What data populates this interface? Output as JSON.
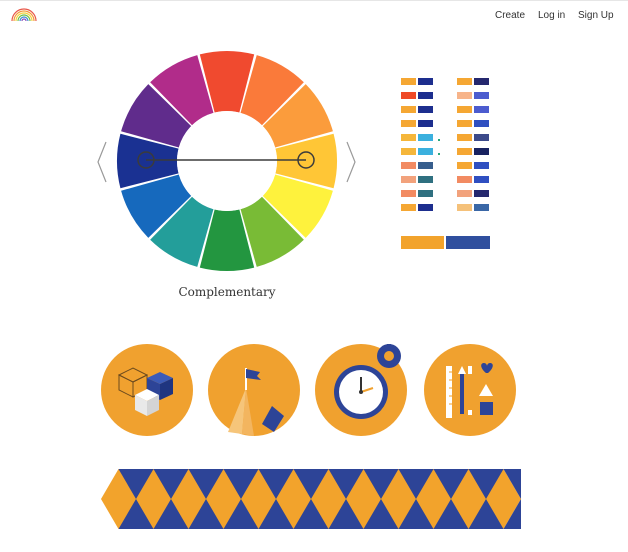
{
  "header": {
    "logo_icon": "rainbow-logo",
    "nav": [
      {
        "label": "Create"
      },
      {
        "label": "Log in"
      },
      {
        "label": "Sign Up"
      }
    ]
  },
  "wheel": {
    "scheme_label": "Complementary",
    "segment_colors": [
      "#f04a2f",
      "#fa7a3a",
      "#fb9c3c",
      "#ffc636",
      "#fef23d",
      "#79bb36",
      "#239640",
      "#239e9a",
      "#1669bd",
      "#1a3192",
      "#602c8c",
      "#b12c8a"
    ],
    "inner_color": "#ffffff",
    "handle_color": "#3b3b3b",
    "prev_icon": "chevron-left-icon",
    "next_icon": "chevron-right-icon"
  },
  "palettes": {
    "left": [
      [
        "#f5a733",
        "#1d2e8e"
      ],
      [
        "#ef4927",
        "#1d2e8e"
      ],
      [
        "#f5a733",
        "#1d2e8e"
      ],
      [
        "#f5a733",
        "#1d2e8e"
      ],
      [
        "#f5b63a",
        "#3bb0de"
      ],
      [
        "#f5b63a",
        "#3bb0de"
      ],
      [
        "#f28b62",
        "#375e8d"
      ],
      [
        "#f2a27c",
        "#2f7080"
      ],
      [
        "#f28b62",
        "#2f7080"
      ],
      [
        "#f5a733",
        "#1d2e8e"
      ]
    ],
    "right": [
      [
        "#f5a733",
        "#25286e"
      ],
      [
        "#f7b48a",
        "#4c5ccf"
      ],
      [
        "#f5a733",
        "#4c5ccf"
      ],
      [
        "#f5a733",
        "#2f4fc1"
      ],
      [
        "#f5a733",
        "#3c4a8a"
      ],
      [
        "#f5a733",
        "#182260"
      ],
      [
        "#f5a733",
        "#2f4fc1"
      ],
      [
        "#f28b62",
        "#2f4fc1"
      ],
      [
        "#f2a27c",
        "#25286e"
      ],
      [
        "#f5c17a",
        "#3a67a6"
      ]
    ],
    "bars": [
      "#f2a32c",
      "#2f4f9e"
    ]
  },
  "illustrations": {
    "orange": "#f0a12f",
    "blue": "#2d4497",
    "items": [
      {
        "icon": "cube-blocks-icon"
      },
      {
        "icon": "mountain-flag-icon"
      },
      {
        "icon": "clock-gear-icon"
      },
      {
        "icon": "design-tools-icon"
      }
    ]
  },
  "pattern": {
    "icon": "triangle-pattern",
    "colors": [
      "#f2a32c",
      "#2d4497"
    ]
  }
}
